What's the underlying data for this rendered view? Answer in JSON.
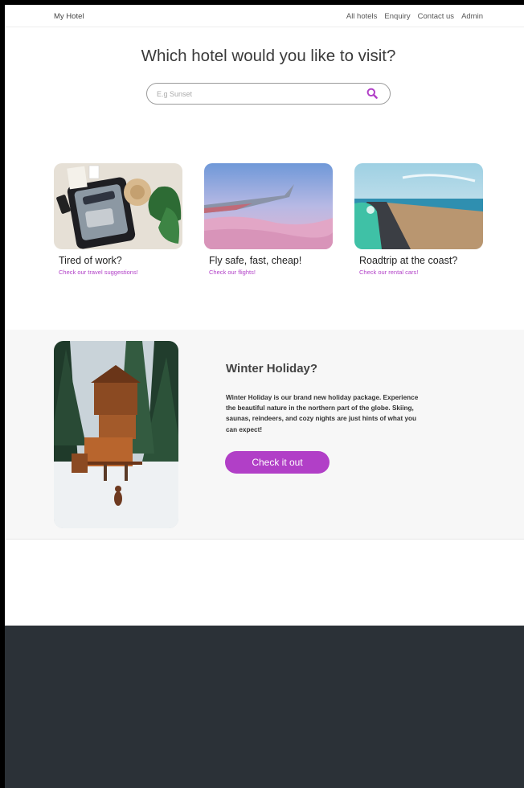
{
  "nav": {
    "brand": "My Hotel",
    "links": [
      "All hotels",
      "Enquiry",
      "Contact us",
      "Admin"
    ]
  },
  "hero": {
    "title": "Which hotel would you like to visit?",
    "search_placeholder": "E.g Sunset",
    "search_icon": "search-icon"
  },
  "cards": [
    {
      "title": "Tired of work?",
      "link": "Check our travel suggestions!"
    },
    {
      "title": "Fly safe, fast, cheap!",
      "link": "Check our flights!"
    },
    {
      "title": "Roadtrip at the coast?",
      "link": "Check our rental cars!"
    }
  ],
  "feature": {
    "title": "Winter Holiday?",
    "body": "Winter Holiday is our brand new holiday package. Experience the beautiful nature in the northern part of the globe. Skiing, saunas, reindeers, and cozy nights are just hints of what you can expect!",
    "button": "Check it out"
  },
  "colors": {
    "accent": "#b13fc7",
    "footer": "#2b3137",
    "feature_bg": "#f7f7f7"
  }
}
